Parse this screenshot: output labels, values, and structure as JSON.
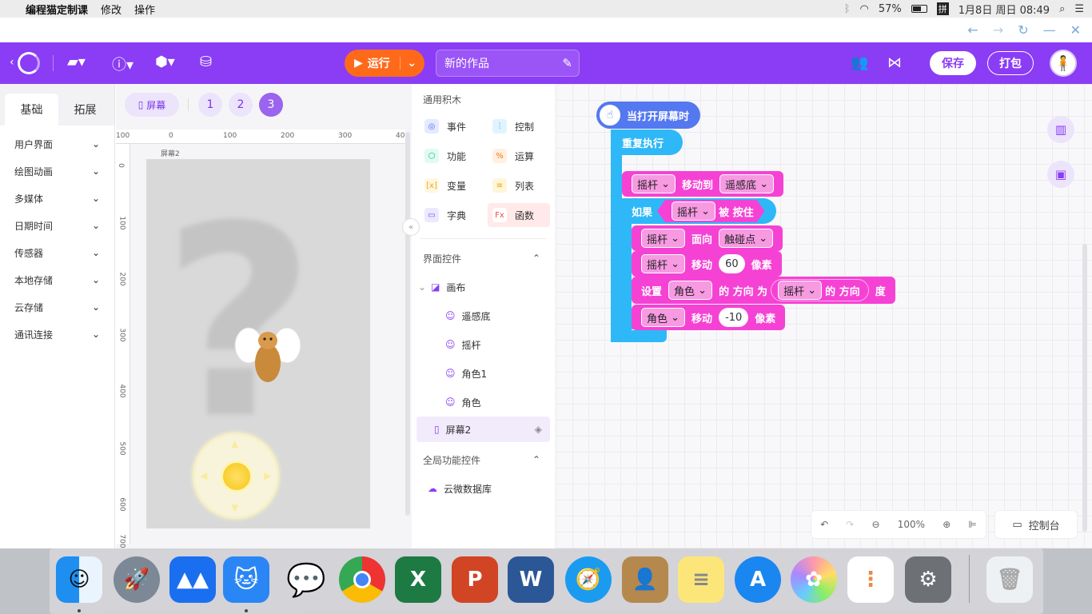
{
  "menubar": {
    "app": "编程猫定制课",
    "items": [
      "修改",
      "操作"
    ],
    "battery": "57%",
    "input_method": "拼",
    "datetime": "1月8日 周日 08:49"
  },
  "toolbar": {
    "run_label": "运行",
    "project_title": "新的作品",
    "save_label": "保存",
    "pack_label": "打包"
  },
  "left_tabs": [
    "基础",
    "拓展"
  ],
  "categories": [
    "用户界面",
    "绘图动画",
    "多媒体",
    "日期时间",
    "传感器",
    "本地存储",
    "云存储",
    "通讯连接"
  ],
  "stage": {
    "screen_button": "屏幕",
    "pages": [
      "1",
      "2",
      "3"
    ],
    "ruler_top": [
      "100",
      "0",
      "100",
      "200",
      "300",
      "40"
    ],
    "ruler_left": [
      "0",
      "100",
      "200",
      "300",
      "400",
      "500",
      "600",
      "700"
    ],
    "screen_label": "屏幕2"
  },
  "blocks_panel": {
    "common_title": "通用积木",
    "common": [
      {
        "label": "事件",
        "color": "#e6eaff",
        "fg": "#4a6cf5",
        "icon": "◎"
      },
      {
        "label": "控制",
        "color": "#e0f4ff",
        "fg": "#1f9be0",
        "icon": "⫶"
      },
      {
        "label": "功能",
        "color": "#e0fbf2",
        "fg": "#14b89a",
        "icon": "⬡"
      },
      {
        "label": "运算",
        "color": "#fff0e0",
        "fg": "#f07a1a",
        "icon": "%"
      },
      {
        "label": "变量",
        "color": "#fff7e0",
        "fg": "#f0a91a",
        "icon": "[x]"
      },
      {
        "label": "列表",
        "color": "#fff5d8",
        "fg": "#e8a512",
        "icon": "≡"
      },
      {
        "label": "字典",
        "color": "#ece8ff",
        "fg": "#6a55e8",
        "icon": "▭"
      },
      {
        "label": "函数",
        "color": "#ffe6e6",
        "fg": "#f04a4a",
        "icon": "Fx"
      }
    ],
    "ui_controls_title": "界面控件",
    "tree": {
      "canvas": "画布",
      "children": [
        "遥感底",
        "摇杆",
        "角色1",
        "角色"
      ],
      "screen": "屏幕2"
    },
    "global_title": "全局功能控件",
    "global_items": [
      "云微数据库"
    ]
  },
  "script": {
    "event": "当打开屏幕时",
    "loop": "重复执行",
    "b1": {
      "obj": "摇杆",
      "verb": "移动到",
      "target": "遥感底"
    },
    "if_label": "如果",
    "cond": {
      "obj": "摇杆",
      "state": "被 按住"
    },
    "b2": {
      "obj": "摇杆",
      "verb": "面向",
      "target": "触碰点"
    },
    "b3": {
      "obj": "摇杆",
      "verb": "移动",
      "value": "60",
      "unit": "像素"
    },
    "b4": {
      "set": "设置",
      "obj": "角色",
      "mid": "的 方向 为",
      "src": "摇杆",
      "srcprop": "的 方向",
      "unit": "度"
    },
    "b5": {
      "obj": "角色",
      "verb": "移动",
      "value": "-10",
      "unit": "像素"
    }
  },
  "workspace": {
    "zoom": "100%",
    "console_label": "控制台"
  },
  "colors": {
    "brand": "#8b3cf5",
    "run": "#ff6a1a",
    "magenta": "#f542d4",
    "cyan": "#2fb8f7"
  }
}
